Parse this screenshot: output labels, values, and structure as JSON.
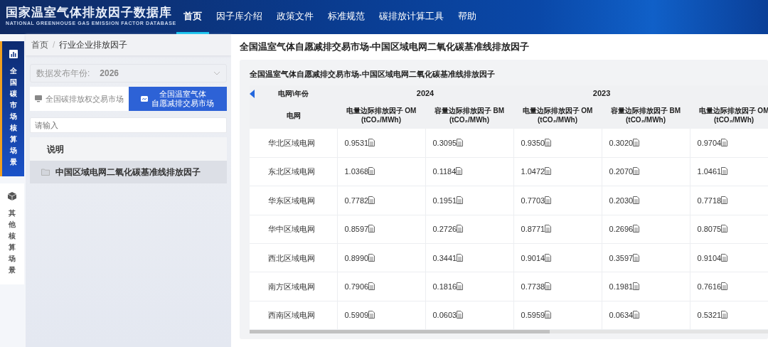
{
  "header": {
    "title": "国家温室气体排放因子数据库",
    "subtitle": "NATIONAL GREENHOUSE GAS EMISSION FACTOR  DATABASE",
    "nav": [
      {
        "label": "首页",
        "selected": true
      },
      {
        "label": "因子库介绍",
        "selected": false
      },
      {
        "label": "政策文件",
        "selected": false
      },
      {
        "label": "标准规范",
        "selected": false
      },
      {
        "label": "碳排放计算工具",
        "selected": false
      },
      {
        "label": "帮助",
        "selected": false
      }
    ]
  },
  "rail": [
    {
      "label": "全国碳市场核算场景",
      "kind": "chart",
      "selected": true
    },
    {
      "label": "其他核算场景",
      "kind": "cube",
      "selected": false
    }
  ],
  "breadcrumb": [
    "首页",
    "行业企业排放因子"
  ],
  "breadcrumb_separator": "/",
  "year_select": {
    "label": "数据发布年份:",
    "value": "2026"
  },
  "market_toggle": [
    {
      "label": "全国碳排放权交易市场",
      "kind": "monitor",
      "selected": false
    },
    {
      "label": "全国温室气体",
      "label_line_2": "自愿减排交易市场",
      "kind": "box",
      "selected": true
    }
  ],
  "search": {
    "placeholder": "请输入"
  },
  "tree": [
    {
      "label": "说明",
      "kind": "header",
      "selected": false
    },
    {
      "label": "中国区域电网二氧化碳基准线排放因子",
      "kind": "folder",
      "selected": true
    }
  ],
  "page_title": "全国温室气体自愿减排交易市场-中国区域电网二氧化碳基准线排放因子",
  "table": {
    "title": "全国温室气体自愿减排交易市场-中国区域电网二氧化碳基准线排放因子",
    "corner": "电网\\年份",
    "row_header": "电网",
    "groups": [
      {
        "year": "2024",
        "columns": [
          {
            "name": "电量边际排放因子 OM",
            "unit": "(tCO₂/MWh)"
          },
          {
            "name": "容量边际排放因子 BM",
            "unit": "(tCO₂/MWh)"
          }
        ]
      },
      {
        "year": "2023",
        "columns": [
          {
            "name": "电量边际排放因子 OM",
            "unit": "(tCO₂/MWh)"
          },
          {
            "name": "容量边际排放因子 BM",
            "unit": "(tCO₂/MWh)"
          }
        ]
      },
      {
        "columns": [
          {
            "name": "电量边际排放因子 OM",
            "unit": "(tCO₂/MWh)"
          }
        ]
      }
    ],
    "rows": [
      {
        "grid": "华北区域电网",
        "values": [
          "0.9531",
          "0.3095",
          "0.9350",
          "0.3020",
          "0.9704"
        ]
      },
      {
        "grid": "东北区域电网",
        "values": [
          "1.0368",
          "0.1184",
          "1.0472",
          "0.2070",
          "1.0461"
        ]
      },
      {
        "grid": "华东区域电网",
        "values": [
          "0.7782",
          "0.1951",
          "0.7703",
          "0.2030",
          "0.7718"
        ]
      },
      {
        "grid": "华中区域电网",
        "values": [
          "0.8597",
          "0.2726",
          "0.8771",
          "0.2696",
          "0.8075"
        ]
      },
      {
        "grid": "西北区域电网",
        "values": [
          "0.8990",
          "0.3441",
          "0.9014",
          "0.3597",
          "0.9104"
        ]
      },
      {
        "grid": "南方区域电网",
        "values": [
          "0.7906",
          "0.1816",
          "0.7738",
          "0.1981",
          "0.7616"
        ]
      },
      {
        "grid": "西南区域电网",
        "values": [
          "0.5909",
          "0.0603",
          "0.5959",
          "0.0634",
          "0.5321"
        ]
      }
    ]
  }
}
